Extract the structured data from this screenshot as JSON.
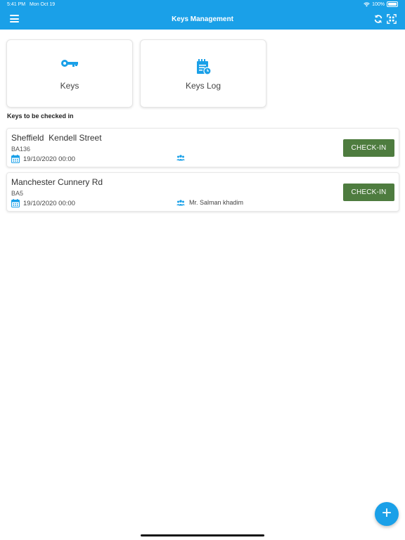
{
  "status_bar": {
    "time": "5:41 PM",
    "date": "Mon Oct 19",
    "battery": "100%"
  },
  "header": {
    "title": "Keys Management",
    "bg_color": "#1aa0e8"
  },
  "tiles": [
    {
      "label": "Keys",
      "icon": "key-icon"
    },
    {
      "label": "Keys Log",
      "icon": "clipboard-calendar-icon"
    }
  ],
  "section": {
    "heading": "Keys to be checked in"
  },
  "keys": [
    {
      "title": "Sheffield  Kendell Street",
      "code": "BA136",
      "date": "19/10/2020 00:00",
      "person": "",
      "button": "CHECK-IN"
    },
    {
      "title": "Manchester Cunnery Rd",
      "code": "BA5",
      "date": "19/10/2020 00:00",
      "person": "Mr. Salman khadim",
      "button": "CHECK-IN"
    }
  ],
  "colors": {
    "accent": "#1aa0e8",
    "checkin": "#4e7c3f"
  }
}
